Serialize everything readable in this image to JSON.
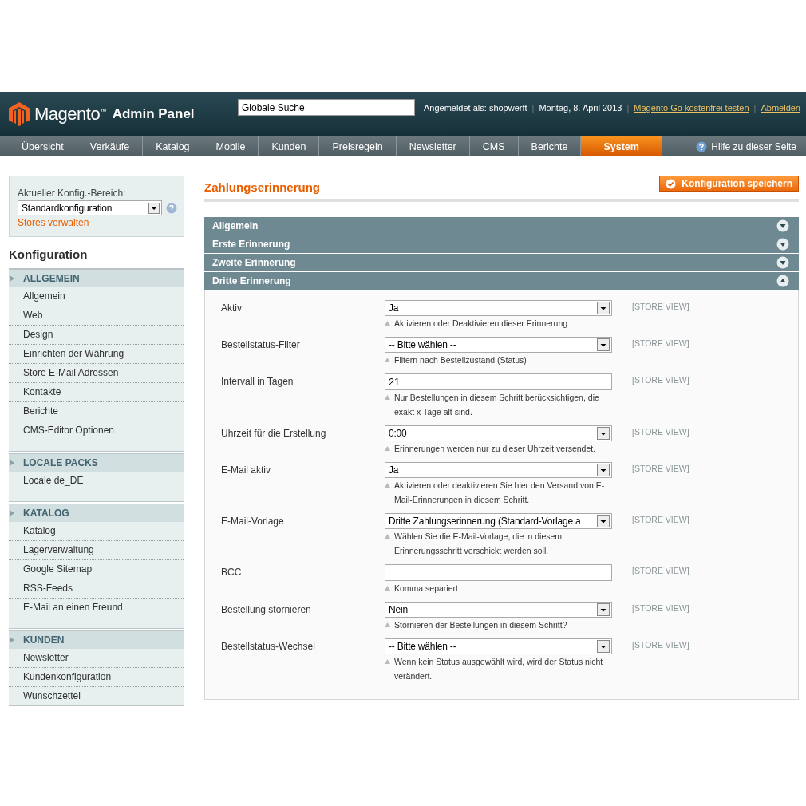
{
  "header": {
    "logo_name": "Magento$^{™}$",
    "logo_suffix": "Admin Panel",
    "search": {
      "value": "Globale Suche"
    },
    "meta": [
      {
        "kind": "text",
        "text": "Angemeldet als: shopwerft"
      },
      {
        "kind": "separator",
        "text": "|"
      },
      {
        "kind": "text",
        "text": "Montag, 8. April 2013"
      },
      {
        "kind": "separator",
        "text": "|"
      },
      {
        "kind": "link",
        "text": "Magento Go kostenfrei testen"
      },
      {
        "kind": "separator",
        "text": "|"
      },
      {
        "kind": "link",
        "text": "Abmelden"
      }
    ]
  },
  "nav": {
    "items": [
      {
        "label": "Übersicht",
        "selected": false
      },
      {
        "label": "Verkäufe",
        "selected": false
      },
      {
        "label": "Katalog",
        "selected": false
      },
      {
        "label": "Mobile",
        "selected": false
      },
      {
        "label": "Kunden",
        "selected": false
      },
      {
        "label": "Preisregeln",
        "selected": false
      },
      {
        "label": "Newsletter",
        "selected": false
      },
      {
        "label": "CMS",
        "selected": false
      },
      {
        "label": "Berichte",
        "selected": false
      },
      {
        "label": "System",
        "selected": true
      }
    ],
    "help": "Hilfe zu dieser Seite"
  },
  "sidebar": {
    "scope_label": "Aktueller Konfig.-Bereich:",
    "scope_value": "Standardkonfiguration",
    "stores_link": "Stores verwalten",
    "title": "Konfiguration",
    "sections": [
      {
        "heading": "ALLGEMEIN",
        "items": [
          "Allgemein",
          "Web",
          "Design",
          "Einrichten der Währung",
          "Store E-Mail Adressen",
          "Kontakte",
          "Berichte",
          "CMS-Editor Optionen"
        ]
      },
      {
        "heading": "LOCALE PACKS",
        "items": [
          "Locale de_DE"
        ]
      },
      {
        "heading": "KATALOG",
        "items": [
          "Katalog",
          "Lagerverwaltung",
          "Google Sitemap",
          "RSS-Feeds",
          "E-Mail an einen Freund"
        ]
      },
      {
        "heading": "KUNDEN",
        "items": [
          "Newsletter",
          "Kundenkonfiguration",
          "Wunschzettel"
        ]
      }
    ]
  },
  "main": {
    "title": "Zahlungserinnerung",
    "save_button": "Konfiguration speichern",
    "groups": [
      {
        "title": "Allgemein",
        "expanded": false
      },
      {
        "title": "Erste Erinnerung",
        "expanded": false
      },
      {
        "title": "Zweite Erinnerung",
        "expanded": false
      },
      {
        "title": "Dritte Erinnerung",
        "expanded": true
      }
    ],
    "fields": [
      {
        "label": "Aktiv",
        "kind": "select",
        "value": "Ja",
        "hint": "Aktivieren oder Deaktivieren dieser Erinnerung",
        "scope": "[STORE VIEW]"
      },
      {
        "label": "Bestellstatus-Filter",
        "kind": "select",
        "value": "-- Bitte wählen --",
        "hint": "Filtern nach Bestellzustand (Status)",
        "scope": "[STORE VIEW]"
      },
      {
        "label": "Intervall in Tagen",
        "kind": "text",
        "value": "21",
        "hint": "Nur Bestellungen in diesem Schritt berücksichtigen, die exakt x Tage alt sind.",
        "scope": "[STORE VIEW]"
      },
      {
        "label": "Uhrzeit für die Erstellung",
        "kind": "select",
        "value": "0:00",
        "hint": "Erinnerungen werden nur zu dieser Uhrzeit versendet.",
        "scope": "[STORE VIEW]"
      },
      {
        "label": "E-Mail aktiv",
        "kind": "select",
        "value": "Ja",
        "hint": "Aktivieren oder deaktivieren Sie hier den Versand von E-Mail-Erinnerungen in diesem Schritt.",
        "scope": "[STORE VIEW]"
      },
      {
        "label": "E-Mail-Vorlage",
        "kind": "select",
        "value": "Dritte Zahlungserinnerung (Standard-Vorlage a",
        "hint": "Wählen Sie die E-Mail-Vorlage, die in diesem Erinnerungsschritt verschickt werden soll.",
        "scope": "[STORE VIEW]"
      },
      {
        "label": "BCC",
        "kind": "text",
        "hint": "Komma separiert",
        "scope": "[STORE VIEW]"
      },
      {
        "label": "Bestellung stornieren",
        "kind": "select",
        "value": "Nein",
        "hint": "Stornieren der Bestellungen in diesem Schritt?",
        "scope": "[STORE VIEW]"
      },
      {
        "label": "Bestellstatus-Wechsel",
        "kind": "select",
        "value": "-- Bitte wählen --",
        "hint": "Wenn kein Status ausgewählt wird, wird der Status nicht verändert.",
        "scope": "[STORE VIEW]"
      }
    ]
  }
}
